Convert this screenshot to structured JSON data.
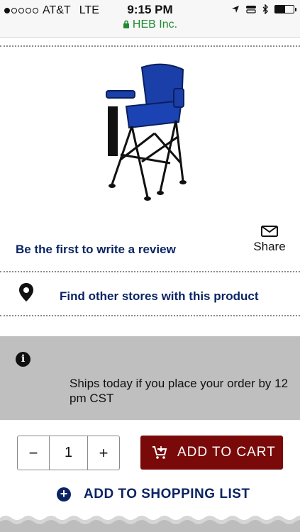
{
  "status_bar": {
    "carrier": "AT&T",
    "network": "LTE",
    "time": "9:15 PM",
    "url_label": "HEB Inc.",
    "signal_bars_filled": 1,
    "signal_bars_total": 5,
    "battery_level": 0.55
  },
  "product": {
    "image_icon": "folding-high-chair-image",
    "review_link": "Be the first to write a review",
    "share_label": "Share",
    "share_icon": "envelope-icon"
  },
  "store_locator": {
    "icon": "location-pin-icon",
    "label": "Find other stores with this product"
  },
  "shipping_notice": {
    "icon": "info-icon",
    "text": "Ships today if you place your order by 12 pm CST"
  },
  "quantity": {
    "decrement_label": "−",
    "value": "1",
    "increment_label": "+"
  },
  "add_to_cart": {
    "label": "ADD TO CART",
    "icon": "cart-add-icon"
  },
  "shopping_list": {
    "label": "ADD TO SHOPPING LIST",
    "icon": "plus-circle-icon"
  },
  "colors": {
    "navy": "#0a2463",
    "cart_red": "#7a0a0a",
    "secure_green": "#1f8a33",
    "notice_gray": "#bfbfbf"
  }
}
